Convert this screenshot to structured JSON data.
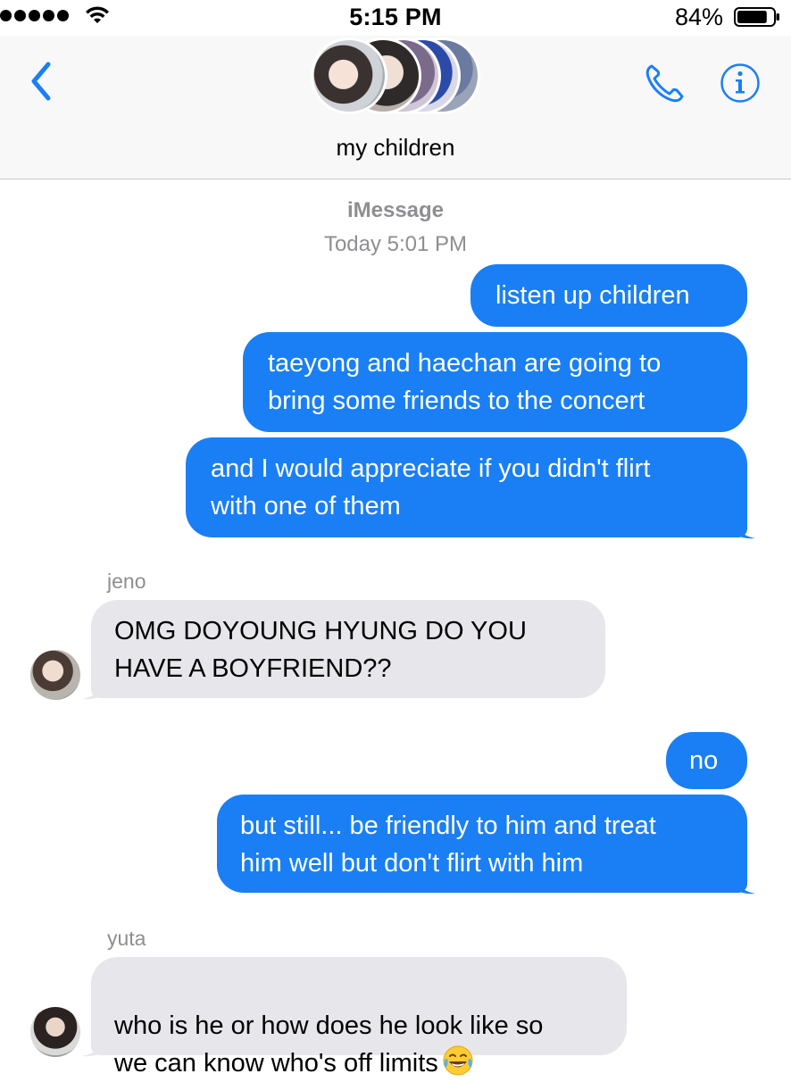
{
  "status_bar": {
    "time": "5:15 PM",
    "battery_percent": "84%",
    "battery_level": 0.84,
    "signal_bars": 5
  },
  "header": {
    "group_name": "my children",
    "back_icon": "chevron-left-icon",
    "call_icon": "phone-icon",
    "info_icon": "info-icon",
    "accent_color": "#1a7ff4"
  },
  "thread": {
    "service_label": "iMessage",
    "timestamp": "Today 5:01 PM",
    "messages": [
      {
        "direction": "sent",
        "text": "listen up children"
      },
      {
        "direction": "sent",
        "text": "taeyong and haechan are going to\nbring some friends to the concert"
      },
      {
        "direction": "sent",
        "text": "and I would appreciate if you didn't flirt\nwith one of them"
      },
      {
        "direction": "received",
        "sender": "jeno",
        "text": "OMG DOYOUNG HYUNG DO YOU\nHAVE A BOYFRIEND??"
      },
      {
        "direction": "sent",
        "text": "no"
      },
      {
        "direction": "sent",
        "text": "but still... be friendly to him and treat\nhim well but don't flirt with him"
      },
      {
        "direction": "received",
        "sender": "yuta",
        "text": "who is he or how does he look like so\nwe can know who's off limits",
        "emoji": "face-with-tears-of-joy"
      }
    ]
  },
  "colors": {
    "sent_bubble": "#1a7ff4",
    "received_bubble": "#e6e6eb",
    "meta_text": "#8e8e93"
  }
}
